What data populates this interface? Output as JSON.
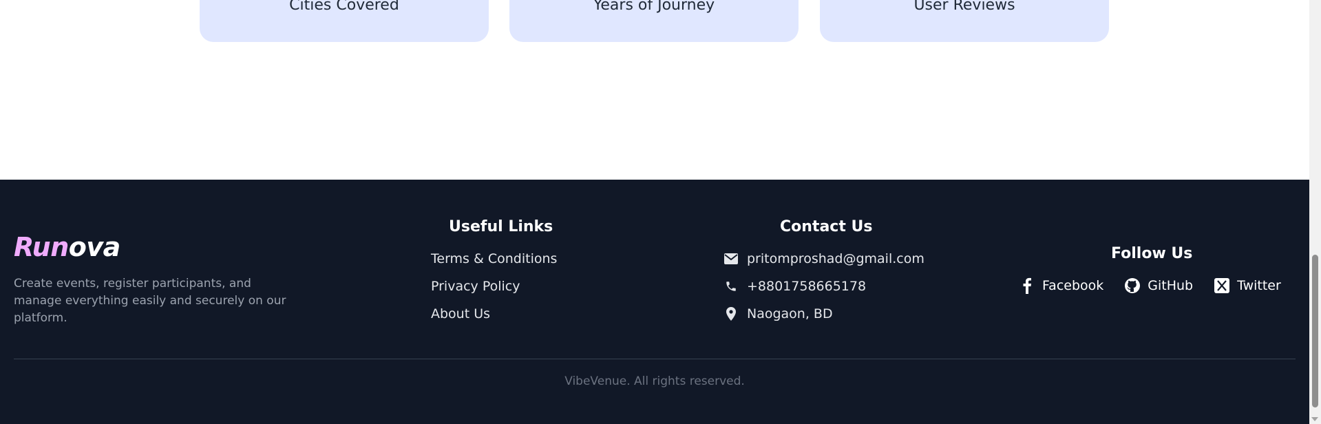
{
  "stats": {
    "cards": [
      {
        "label": "Cities Covered"
      },
      {
        "label": "Years of Journey"
      },
      {
        "label": "User Reviews"
      }
    ]
  },
  "footer": {
    "brand_first": "Run",
    "brand_second": "ova",
    "tagline": "Create events, register participants, and manage everything easily and securely on our platform.",
    "useful_links": {
      "title": "Useful Links",
      "items": [
        "Terms & Conditions",
        "Privacy Policy",
        "About Us"
      ]
    },
    "contact": {
      "title": "Contact Us",
      "email": "pritomproshad@gmail.com",
      "phone": "+8801758665178",
      "location": "Naogaon, BD",
      "icons": [
        "envelope-icon",
        "phone-icon",
        "map-pin-icon"
      ]
    },
    "follow": {
      "title": "Follow Us",
      "items": [
        {
          "label": "Facebook",
          "icon": "facebook-icon"
        },
        {
          "label": "GitHub",
          "icon": "github-icon"
        },
        {
          "label": "Twitter",
          "icon": "x-twitter-icon"
        }
      ]
    },
    "copyright": "VibeVenue. All rights reserved."
  },
  "colors": {
    "card_bg": "#e0e7ff",
    "footer_bg": "#111827",
    "brand_accent": "#f0abfc"
  }
}
